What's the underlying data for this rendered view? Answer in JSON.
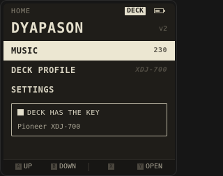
{
  "header": {
    "breadcrumb": "HOME",
    "deck_badge": "DECK",
    "battery_level": 0.6
  },
  "brand": {
    "name": "DYAPASON",
    "version": "v2"
  },
  "menu": {
    "items": [
      {
        "label": "MUSIC",
        "value": "230",
        "selected": true
      },
      {
        "label": "DECK PROFILE",
        "value": "XDJ-700",
        "selected": false
      },
      {
        "label": "SETTINGS",
        "value": "",
        "selected": false
      }
    ]
  },
  "status_card": {
    "title": "DECK HAS THE KEY",
    "subtitle": "Pioneer XDJ-700"
  },
  "footer": {
    "buttons": [
      {
        "key": "A",
        "label": "UP"
      },
      {
        "key": "B",
        "label": "DOWN"
      },
      {
        "key": "X",
        "label": ""
      },
      {
        "key": "Y",
        "label": "OPEN"
      }
    ]
  },
  "colors": {
    "background": "#1f1d19",
    "highlight": "#ece7d2",
    "text": "#d7d2c0",
    "muted": "#8c8677"
  }
}
